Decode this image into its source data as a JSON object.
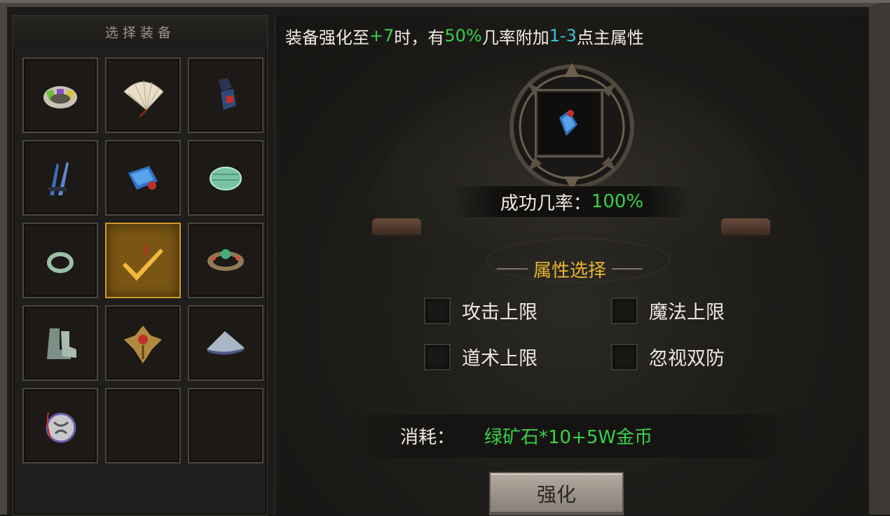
{
  "left_panel": {
    "title": "选择装备",
    "slots": [
      {
        "item": "bracelet-gem-icon"
      },
      {
        "item": "fan-icon"
      },
      {
        "item": "gauntlet-icon"
      },
      {
        "item": "claw-weapon-icon"
      },
      {
        "item": "blue-bracer-icon"
      },
      {
        "item": "jade-bracelet-icon"
      },
      {
        "item": "jade-ring-icon"
      },
      {
        "item": "selected-check-icon"
      },
      {
        "item": "jeweled-ring-icon"
      },
      {
        "item": "boots-icon"
      },
      {
        "item": "eagle-amulet-icon"
      },
      {
        "item": "hat-icon"
      },
      {
        "item": "medallion-icon"
      },
      {
        "item": ""
      },
      {
        "item": ""
      }
    ],
    "selected_index": 7
  },
  "main": {
    "info": {
      "p1": "装备强化至",
      "level": "+7",
      "p2": "时，有",
      "chance": "50%",
      "p3": "几率附加",
      "range": "1-3",
      "p4": "点主属性"
    },
    "success_label": "成功几率：",
    "success_value": "100%",
    "attr_title": "属性选择",
    "options": [
      {
        "label": "攻击上限",
        "checked": false
      },
      {
        "label": "魔法上限",
        "checked": false
      },
      {
        "label": "道术上限",
        "checked": false
      },
      {
        "label": "忽视双防",
        "checked": false
      }
    ],
    "cost_label": "消耗：",
    "cost_value": "绿矿石*10+5W金币",
    "enhance_button": "强化"
  },
  "colors": {
    "green": "#38d147",
    "cyan": "#33c9d6",
    "gold": "#e8b52e"
  }
}
